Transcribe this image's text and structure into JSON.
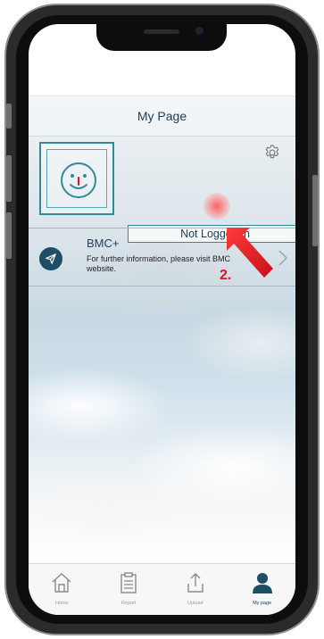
{
  "header": {
    "title": "My Page"
  },
  "profile": {
    "login_status": "Not Logged in"
  },
  "bmc": {
    "title": "BMC+",
    "description": "For further information, please visit BMC website."
  },
  "annotation": {
    "step": "2."
  },
  "tabs": [
    {
      "label": "Home",
      "icon": "home-icon",
      "active": false
    },
    {
      "label": "Report",
      "icon": "report-icon",
      "active": false
    },
    {
      "label": "Upload",
      "icon": "upload-icon",
      "active": false
    },
    {
      "label": "My page",
      "icon": "user-icon",
      "active": true
    }
  ],
  "colors": {
    "accent": "#2e8a9c",
    "text_primary": "#1f3d5a",
    "annotation": "#d7191f",
    "icon_dark": "#1d4e63"
  }
}
